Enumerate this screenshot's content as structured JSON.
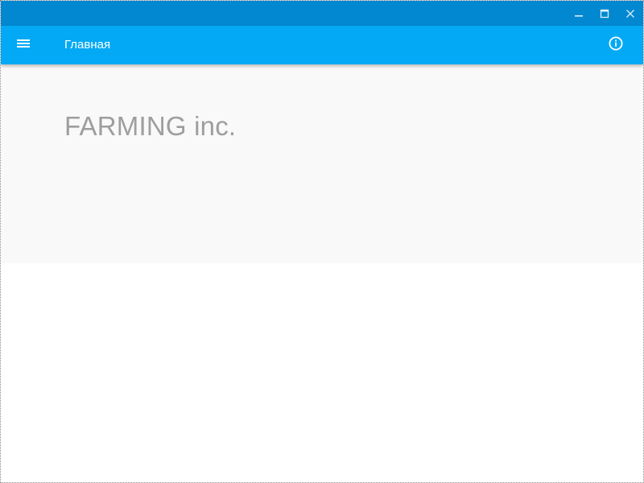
{
  "window": {
    "controls": {
      "minimize_icon": "minimize-icon",
      "maximize_icon": "maximize-icon",
      "close_icon": "close-icon"
    }
  },
  "appbar": {
    "menu_icon": "hamburger-menu-icon",
    "title": "Главная",
    "info_icon": "info-icon"
  },
  "hero": {
    "title": "FARMING inc."
  },
  "colors": {
    "titlebar": "#0288d1",
    "appbar": "#03a9f4",
    "hero_background": "#f9f9f9",
    "hero_text": "#9e9e9e"
  }
}
